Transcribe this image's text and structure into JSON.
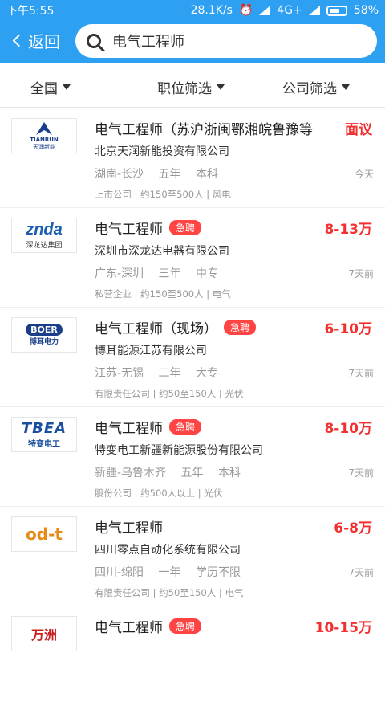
{
  "status": {
    "time": "下午5:55",
    "speed": "28.1K/s",
    "network": "4G+",
    "battery": "58%"
  },
  "header": {
    "back_label": "返回",
    "search_value": "电气工程师"
  },
  "filters": [
    {
      "label": "全国"
    },
    {
      "label": "职位筛选"
    },
    {
      "label": "公司筛选"
    }
  ],
  "jobs": [
    {
      "logo_text": "TIANRUN",
      "logo_sub": "天润新能",
      "title": "电气工程师（苏沪浙闽鄂湘皖鲁豫等",
      "badge": "",
      "salary": "面议",
      "company": "北京天润新能投资有限公司",
      "city": "湖南-长沙",
      "exp": "五年",
      "edu": "本科",
      "time": "今天",
      "tags": "上市公司 | 约150至500人 | 风电"
    },
    {
      "logo_text": "znda",
      "logo_sub": "深龙达集团",
      "title": "电气工程师",
      "badge": "急聘",
      "salary": "8-13万",
      "company": "深圳市深龙达电器有限公司",
      "city": "广东-深圳",
      "exp": "三年",
      "edu": "中专",
      "time": "7天前",
      "tags": "私营企业 | 约150至500人 | 电气"
    },
    {
      "logo_text": "BOER",
      "logo_sub": "博耳电力",
      "title": "电气工程师（现场）",
      "badge": "急聘",
      "salary": "6-10万",
      "company": "博耳能源江苏有限公司",
      "city": "江苏-无锡",
      "exp": "二年",
      "edu": "大专",
      "time": "7天前",
      "tags": "有限责任公司 | 约50至150人 | 光伏"
    },
    {
      "logo_text": "TBEA",
      "logo_sub": "特变电工",
      "title": "电气工程师",
      "badge": "急聘",
      "salary": "8-10万",
      "company": "特变电工新疆新能源股份有限公司",
      "city": "新疆-乌鲁木齐",
      "exp": "五年",
      "edu": "本科",
      "time": "7天前",
      "tags": "股份公司 | 约500人以上 | 光伏"
    },
    {
      "logo_text": "od-t",
      "logo_sub": "",
      "title": "电气工程师",
      "badge": "",
      "salary": "6-8万",
      "company": "四川零点自动化系统有限公司",
      "city": "四川-绵阳",
      "exp": "一年",
      "edu": "学历不限",
      "time": "7天前",
      "tags": "有限责任公司 | 约50至150人 | 电气"
    },
    {
      "logo_text": "万洲",
      "logo_sub": "",
      "title": "电气工程师",
      "badge": "急聘",
      "salary": "10-15万",
      "company": "",
      "city": "",
      "exp": "",
      "edu": "",
      "time": "",
      "tags": ""
    }
  ],
  "colors": {
    "accent": "#2ea0f2",
    "salary": "#f23030",
    "badge": "#ff4444"
  }
}
